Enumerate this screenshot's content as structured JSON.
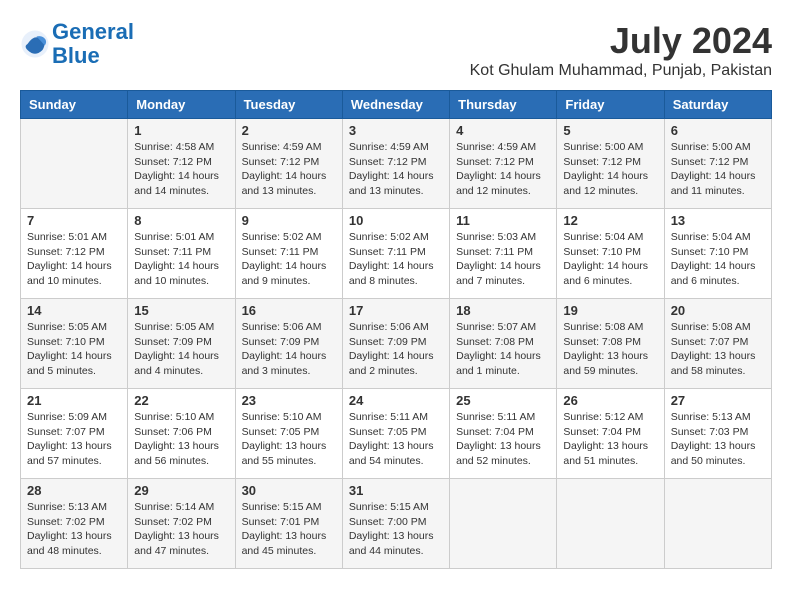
{
  "header": {
    "logo_line1": "General",
    "logo_line2": "Blue",
    "month_title": "July 2024",
    "location": "Kot Ghulam Muhammad, Punjab, Pakistan"
  },
  "days_of_week": [
    "Sunday",
    "Monday",
    "Tuesday",
    "Wednesday",
    "Thursday",
    "Friday",
    "Saturday"
  ],
  "weeks": [
    [
      {
        "day": "",
        "info": ""
      },
      {
        "day": "1",
        "info": "Sunrise: 4:58 AM\nSunset: 7:12 PM\nDaylight: 14 hours\nand 14 minutes."
      },
      {
        "day": "2",
        "info": "Sunrise: 4:59 AM\nSunset: 7:12 PM\nDaylight: 14 hours\nand 13 minutes."
      },
      {
        "day": "3",
        "info": "Sunrise: 4:59 AM\nSunset: 7:12 PM\nDaylight: 14 hours\nand 13 minutes."
      },
      {
        "day": "4",
        "info": "Sunrise: 4:59 AM\nSunset: 7:12 PM\nDaylight: 14 hours\nand 12 minutes."
      },
      {
        "day": "5",
        "info": "Sunrise: 5:00 AM\nSunset: 7:12 PM\nDaylight: 14 hours\nand 12 minutes."
      },
      {
        "day": "6",
        "info": "Sunrise: 5:00 AM\nSunset: 7:12 PM\nDaylight: 14 hours\nand 11 minutes."
      }
    ],
    [
      {
        "day": "7",
        "info": "Sunrise: 5:01 AM\nSunset: 7:12 PM\nDaylight: 14 hours\nand 10 minutes."
      },
      {
        "day": "8",
        "info": "Sunrise: 5:01 AM\nSunset: 7:11 PM\nDaylight: 14 hours\nand 10 minutes."
      },
      {
        "day": "9",
        "info": "Sunrise: 5:02 AM\nSunset: 7:11 PM\nDaylight: 14 hours\nand 9 minutes."
      },
      {
        "day": "10",
        "info": "Sunrise: 5:02 AM\nSunset: 7:11 PM\nDaylight: 14 hours\nand 8 minutes."
      },
      {
        "day": "11",
        "info": "Sunrise: 5:03 AM\nSunset: 7:11 PM\nDaylight: 14 hours\nand 7 minutes."
      },
      {
        "day": "12",
        "info": "Sunrise: 5:04 AM\nSunset: 7:10 PM\nDaylight: 14 hours\nand 6 minutes."
      },
      {
        "day": "13",
        "info": "Sunrise: 5:04 AM\nSunset: 7:10 PM\nDaylight: 14 hours\nand 6 minutes."
      }
    ],
    [
      {
        "day": "14",
        "info": "Sunrise: 5:05 AM\nSunset: 7:10 PM\nDaylight: 14 hours\nand 5 minutes."
      },
      {
        "day": "15",
        "info": "Sunrise: 5:05 AM\nSunset: 7:09 PM\nDaylight: 14 hours\nand 4 minutes."
      },
      {
        "day": "16",
        "info": "Sunrise: 5:06 AM\nSunset: 7:09 PM\nDaylight: 14 hours\nand 3 minutes."
      },
      {
        "day": "17",
        "info": "Sunrise: 5:06 AM\nSunset: 7:09 PM\nDaylight: 14 hours\nand 2 minutes."
      },
      {
        "day": "18",
        "info": "Sunrise: 5:07 AM\nSunset: 7:08 PM\nDaylight: 14 hours\nand 1 minute."
      },
      {
        "day": "19",
        "info": "Sunrise: 5:08 AM\nSunset: 7:08 PM\nDaylight: 13 hours\nand 59 minutes."
      },
      {
        "day": "20",
        "info": "Sunrise: 5:08 AM\nSunset: 7:07 PM\nDaylight: 13 hours\nand 58 minutes."
      }
    ],
    [
      {
        "day": "21",
        "info": "Sunrise: 5:09 AM\nSunset: 7:07 PM\nDaylight: 13 hours\nand 57 minutes."
      },
      {
        "day": "22",
        "info": "Sunrise: 5:10 AM\nSunset: 7:06 PM\nDaylight: 13 hours\nand 56 minutes."
      },
      {
        "day": "23",
        "info": "Sunrise: 5:10 AM\nSunset: 7:05 PM\nDaylight: 13 hours\nand 55 minutes."
      },
      {
        "day": "24",
        "info": "Sunrise: 5:11 AM\nSunset: 7:05 PM\nDaylight: 13 hours\nand 54 minutes."
      },
      {
        "day": "25",
        "info": "Sunrise: 5:11 AM\nSunset: 7:04 PM\nDaylight: 13 hours\nand 52 minutes."
      },
      {
        "day": "26",
        "info": "Sunrise: 5:12 AM\nSunset: 7:04 PM\nDaylight: 13 hours\nand 51 minutes."
      },
      {
        "day": "27",
        "info": "Sunrise: 5:13 AM\nSunset: 7:03 PM\nDaylight: 13 hours\nand 50 minutes."
      }
    ],
    [
      {
        "day": "28",
        "info": "Sunrise: 5:13 AM\nSunset: 7:02 PM\nDaylight: 13 hours\nand 48 minutes."
      },
      {
        "day": "29",
        "info": "Sunrise: 5:14 AM\nSunset: 7:02 PM\nDaylight: 13 hours\nand 47 minutes."
      },
      {
        "day": "30",
        "info": "Sunrise: 5:15 AM\nSunset: 7:01 PM\nDaylight: 13 hours\nand 45 minutes."
      },
      {
        "day": "31",
        "info": "Sunrise: 5:15 AM\nSunset: 7:00 PM\nDaylight: 13 hours\nand 44 minutes."
      },
      {
        "day": "",
        "info": ""
      },
      {
        "day": "",
        "info": ""
      },
      {
        "day": "",
        "info": ""
      }
    ]
  ]
}
